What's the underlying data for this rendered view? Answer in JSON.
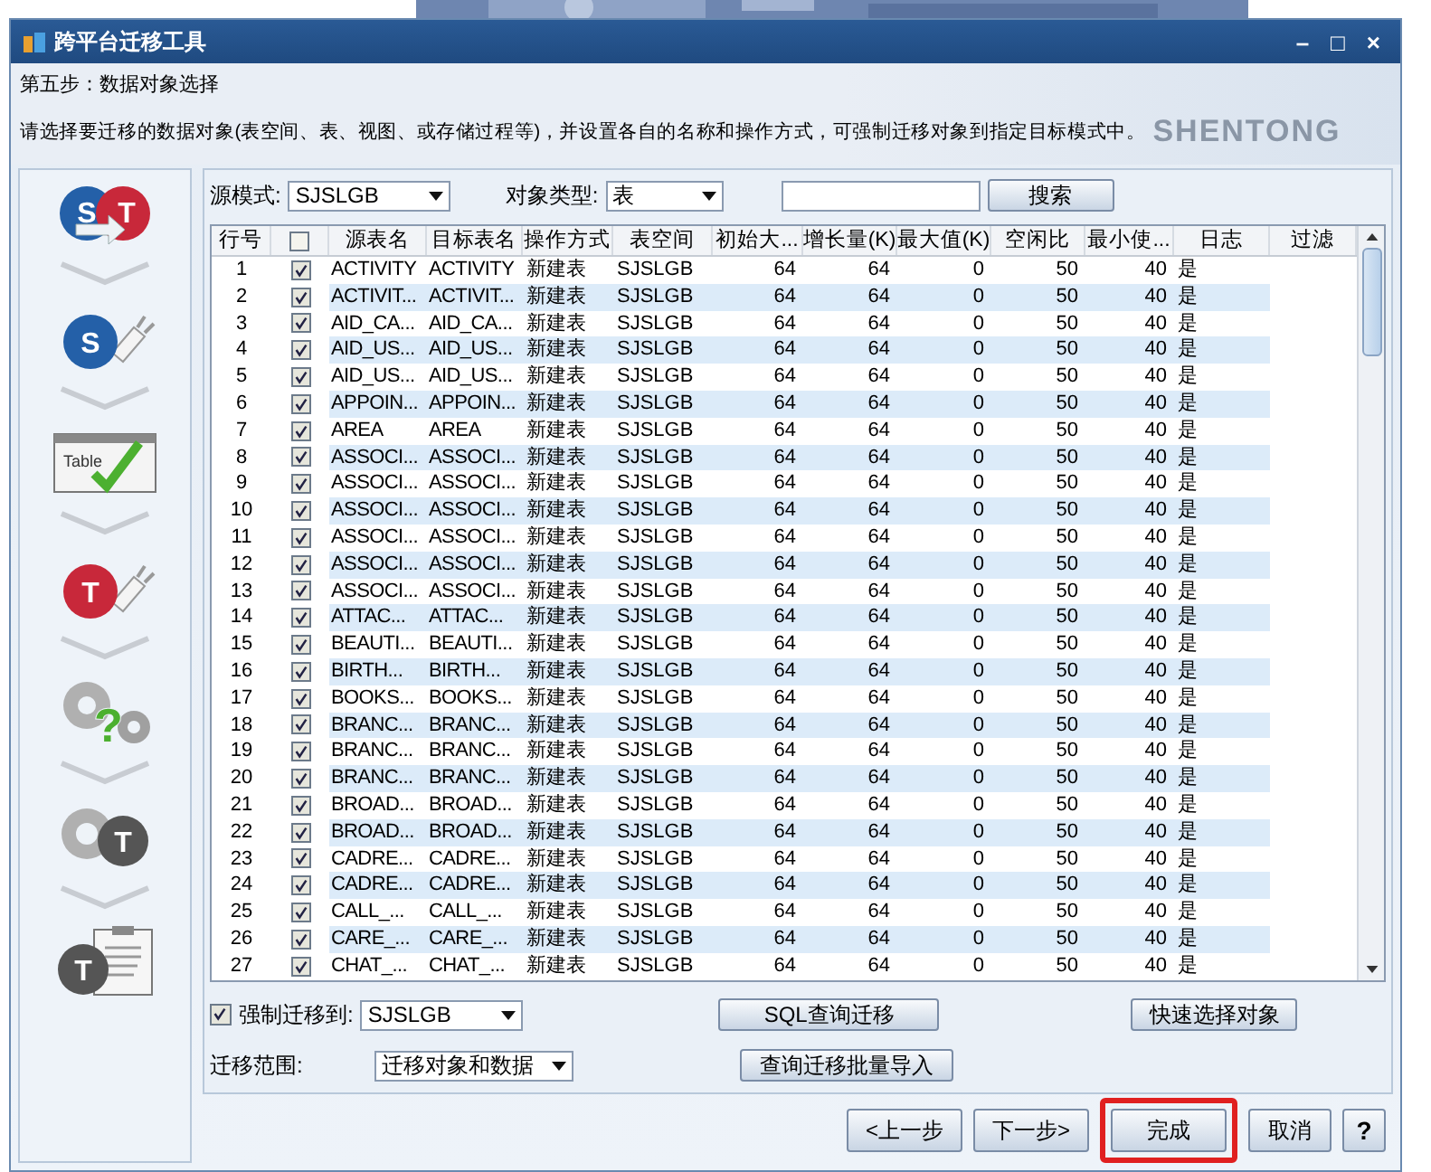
{
  "window": {
    "title": "跨平台迁移工具",
    "controls": [
      "–",
      "□",
      "×"
    ]
  },
  "header": {
    "step": "第五步：数据对象选择",
    "description": "请选择要迁移的数据对象(表空间、表、视图、或存储过程等)，并设置各自的名称和操作方式，可强制迁移对象到指定目标模式中。",
    "logo": "SHENTONG"
  },
  "sidebar": {
    "steps": [
      {
        "kind": "transfer",
        "badges": [
          "S",
          "T"
        ]
      },
      {
        "kind": "source-connect",
        "badges": [
          "S"
        ]
      },
      {
        "kind": "table-check",
        "badges": [
          "Table"
        ]
      },
      {
        "kind": "target-connect",
        "badges": [
          "T"
        ]
      },
      {
        "kind": "gears-question",
        "badges": [
          "?"
        ]
      },
      {
        "kind": "gears-target",
        "badges": [
          "T"
        ]
      },
      {
        "kind": "checklist-target",
        "badges": [
          "T"
        ]
      }
    ]
  },
  "toolbar": {
    "source_schema_label": "源模式:",
    "source_schema": "SJSLGB",
    "object_type_label": "对象类型:",
    "object_type": "表",
    "search_button": "搜索"
  },
  "table": {
    "all_checked": false,
    "columns": [
      "行号",
      "源表名",
      "目标表名",
      "操作方式",
      "表空间",
      "初始大...",
      "增长量(K)",
      "最大值(K)",
      "空闲比",
      "最小使...",
      "日志",
      "过滤"
    ],
    "rows": [
      {
        "checked": true,
        "cells": [
          "1",
          "ACTIVITY",
          "ACTIVITY",
          "新建表",
          "SJSLGB",
          "64",
          "64",
          "0",
          "50",
          "40",
          "是"
        ]
      },
      {
        "checked": true,
        "cells": [
          "2",
          "ACTIVIT...",
          "ACTIVIT...",
          "新建表",
          "SJSLGB",
          "64",
          "64",
          "0",
          "50",
          "40",
          "是"
        ]
      },
      {
        "checked": true,
        "cells": [
          "3",
          "AID_CA...",
          "AID_CA...",
          "新建表",
          "SJSLGB",
          "64",
          "64",
          "0",
          "50",
          "40",
          "是"
        ]
      },
      {
        "checked": true,
        "cells": [
          "4",
          "AID_US...",
          "AID_US...",
          "新建表",
          "SJSLGB",
          "64",
          "64",
          "0",
          "50",
          "40",
          "是"
        ]
      },
      {
        "checked": true,
        "cells": [
          "5",
          "AID_US...",
          "AID_US...",
          "新建表",
          "SJSLGB",
          "64",
          "64",
          "0",
          "50",
          "40",
          "是"
        ]
      },
      {
        "checked": true,
        "cells": [
          "6",
          "APPOIN...",
          "APPOIN...",
          "新建表",
          "SJSLGB",
          "64",
          "64",
          "0",
          "50",
          "40",
          "是"
        ]
      },
      {
        "checked": true,
        "cells": [
          "7",
          "AREA",
          "AREA",
          "新建表",
          "SJSLGB",
          "64",
          "64",
          "0",
          "50",
          "40",
          "是"
        ]
      },
      {
        "checked": true,
        "cells": [
          "8",
          "ASSOCI...",
          "ASSOCI...",
          "新建表",
          "SJSLGB",
          "64",
          "64",
          "0",
          "50",
          "40",
          "是"
        ]
      },
      {
        "checked": true,
        "cells": [
          "9",
          "ASSOCI...",
          "ASSOCI...",
          "新建表",
          "SJSLGB",
          "64",
          "64",
          "0",
          "50",
          "40",
          "是"
        ]
      },
      {
        "checked": true,
        "cells": [
          "10",
          "ASSOCI...",
          "ASSOCI...",
          "新建表",
          "SJSLGB",
          "64",
          "64",
          "0",
          "50",
          "40",
          "是"
        ]
      },
      {
        "checked": true,
        "cells": [
          "11",
          "ASSOCI...",
          "ASSOCI...",
          "新建表",
          "SJSLGB",
          "64",
          "64",
          "0",
          "50",
          "40",
          "是"
        ]
      },
      {
        "checked": true,
        "cells": [
          "12",
          "ASSOCI...",
          "ASSOCI...",
          "新建表",
          "SJSLGB",
          "64",
          "64",
          "0",
          "50",
          "40",
          "是"
        ]
      },
      {
        "checked": true,
        "cells": [
          "13",
          "ASSOCI...",
          "ASSOCI...",
          "新建表",
          "SJSLGB",
          "64",
          "64",
          "0",
          "50",
          "40",
          "是"
        ]
      },
      {
        "checked": true,
        "cells": [
          "14",
          "ATTAC...",
          "ATTAC...",
          "新建表",
          "SJSLGB",
          "64",
          "64",
          "0",
          "50",
          "40",
          "是"
        ]
      },
      {
        "checked": true,
        "cells": [
          "15",
          "BEAUTI...",
          "BEAUTI...",
          "新建表",
          "SJSLGB",
          "64",
          "64",
          "0",
          "50",
          "40",
          "是"
        ]
      },
      {
        "checked": true,
        "cells": [
          "16",
          "BIRTH...",
          "BIRTH...",
          "新建表",
          "SJSLGB",
          "64",
          "64",
          "0",
          "50",
          "40",
          "是"
        ]
      },
      {
        "checked": true,
        "cells": [
          "17",
          "BOOKS...",
          "BOOKS...",
          "新建表",
          "SJSLGB",
          "64",
          "64",
          "0",
          "50",
          "40",
          "是"
        ]
      },
      {
        "checked": true,
        "cells": [
          "18",
          "BRANC...",
          "BRANC...",
          "新建表",
          "SJSLGB",
          "64",
          "64",
          "0",
          "50",
          "40",
          "是"
        ]
      },
      {
        "checked": true,
        "cells": [
          "19",
          "BRANC...",
          "BRANC...",
          "新建表",
          "SJSLGB",
          "64",
          "64",
          "0",
          "50",
          "40",
          "是"
        ]
      },
      {
        "checked": true,
        "cells": [
          "20",
          "BRANC...",
          "BRANC...",
          "新建表",
          "SJSLGB",
          "64",
          "64",
          "0",
          "50",
          "40",
          "是"
        ]
      },
      {
        "checked": true,
        "cells": [
          "21",
          "BROAD...",
          "BROAD...",
          "新建表",
          "SJSLGB",
          "64",
          "64",
          "0",
          "50",
          "40",
          "是"
        ]
      },
      {
        "checked": true,
        "cells": [
          "22",
          "BROAD...",
          "BROAD...",
          "新建表",
          "SJSLGB",
          "64",
          "64",
          "0",
          "50",
          "40",
          "是"
        ]
      },
      {
        "checked": true,
        "cells": [
          "23",
          "CADRE...",
          "CADRE...",
          "新建表",
          "SJSLGB",
          "64",
          "64",
          "0",
          "50",
          "40",
          "是"
        ]
      },
      {
        "checked": true,
        "cells": [
          "24",
          "CADRE...",
          "CADRE...",
          "新建表",
          "SJSLGB",
          "64",
          "64",
          "0",
          "50",
          "40",
          "是"
        ]
      },
      {
        "checked": true,
        "cells": [
          "25",
          "CALL_...",
          "CALL_...",
          "新建表",
          "SJSLGB",
          "64",
          "64",
          "0",
          "50",
          "40",
          "是"
        ]
      },
      {
        "checked": true,
        "cells": [
          "26",
          "CARE_...",
          "CARE_...",
          "新建表",
          "SJSLGB",
          "64",
          "64",
          "0",
          "50",
          "40",
          "是"
        ]
      },
      {
        "checked": true,
        "cells": [
          "27",
          "CHAT_...",
          "CHAT_...",
          "新建表",
          "SJSLGB",
          "64",
          "64",
          "0",
          "50",
          "40",
          "是"
        ]
      }
    ]
  },
  "options": {
    "force_checked": true,
    "force_label": "强制迁移到:",
    "force_schema": "SJSLGB",
    "scope_label": "迁移范围:",
    "scope": "迁移对象和数据",
    "sql_button": "SQL查询迁移",
    "batch_button": "查询迁移批量导入",
    "quick_button": "快速选择对象"
  },
  "nav": [
    {
      "label": "<上一步",
      "highlighted": false
    },
    {
      "label": "下一步>",
      "highlighted": false
    },
    {
      "label": "完成",
      "highlighted": true
    },
    {
      "label": "取消",
      "highlighted": false
    }
  ],
  "help": "?"
}
